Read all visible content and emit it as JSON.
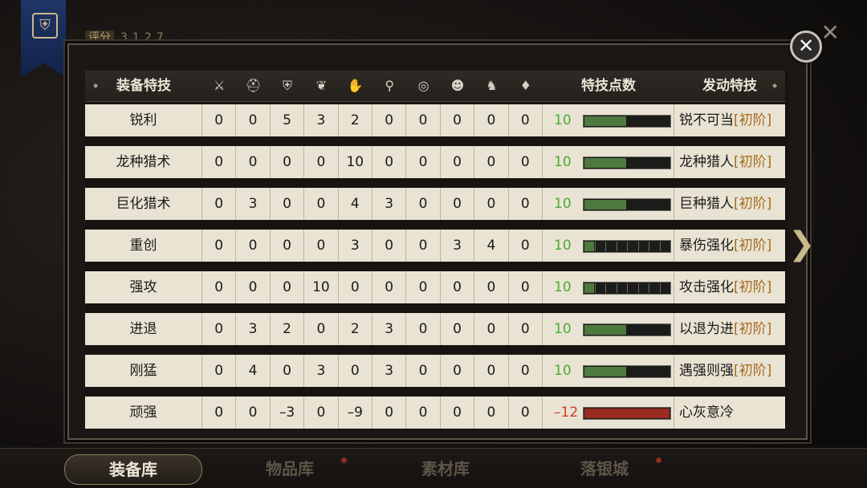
{
  "header": {
    "score_label": "评分",
    "score_value": "3127"
  },
  "table": {
    "col_name": "装备特技",
    "col_points": "特技点数",
    "col_activate": "发动特技",
    "slot_icons": [
      {
        "name": "sword-icon",
        "glyph": "⚔"
      },
      {
        "name": "helmet-icon",
        "glyph": "⛑"
      },
      {
        "name": "armor-icon",
        "glyph": "⛨"
      },
      {
        "name": "shoulder-icon",
        "glyph": "❦"
      },
      {
        "name": "gauntlet-icon",
        "glyph": "✋"
      },
      {
        "name": "boots-icon",
        "glyph": "⚲"
      },
      {
        "name": "ring-icon",
        "glyph": "◎"
      },
      {
        "name": "mask-icon",
        "glyph": "☻"
      },
      {
        "name": "mount-icon",
        "glyph": "♞"
      },
      {
        "name": "gem-icon",
        "glyph": "♦"
      }
    ],
    "rows": [
      {
        "name": "锐利",
        "vals": [
          "0",
          "0",
          "5",
          "3",
          "2",
          "0",
          "0",
          "0",
          "0",
          "0"
        ],
        "points": "10",
        "fill": 0.5,
        "segmented": false,
        "activate": "锐不可当",
        "tag": "[初阶]"
      },
      {
        "name": "龙种猎术",
        "vals": [
          "0",
          "0",
          "0",
          "0",
          "10",
          "0",
          "0",
          "0",
          "0",
          "0"
        ],
        "points": "10",
        "fill": 0.5,
        "segmented": false,
        "activate": "龙种猎人",
        "tag": "[初阶]"
      },
      {
        "name": "巨化猎术",
        "vals": [
          "0",
          "3",
          "0",
          "0",
          "4",
          "3",
          "0",
          "0",
          "0",
          "0"
        ],
        "points": "10",
        "fill": 0.5,
        "segmented": false,
        "activate": "巨种猎人",
        "tag": "[初阶]"
      },
      {
        "name": "重创",
        "vals": [
          "0",
          "0",
          "0",
          "0",
          "3",
          "0",
          "0",
          "3",
          "4",
          "0"
        ],
        "points": "10",
        "fill": 0.125,
        "segmented": true,
        "activate": "暴伤强化",
        "tag": "[初阶]"
      },
      {
        "name": "强攻",
        "vals": [
          "0",
          "0",
          "0",
          "10",
          "0",
          "0",
          "0",
          "0",
          "0",
          "0"
        ],
        "points": "10",
        "fill": 0.125,
        "segmented": true,
        "activate": "攻击强化",
        "tag": "[初阶]"
      },
      {
        "name": "进退",
        "vals": [
          "0",
          "3",
          "2",
          "0",
          "2",
          "3",
          "0",
          "0",
          "0",
          "0"
        ],
        "points": "10",
        "fill": 0.5,
        "segmented": false,
        "activate": "以退为进",
        "tag": "[初阶]"
      },
      {
        "name": "刚猛",
        "vals": [
          "0",
          "4",
          "0",
          "3",
          "0",
          "3",
          "0",
          "0",
          "0",
          "0"
        ],
        "points": "10",
        "fill": 0.5,
        "segmented": false,
        "activate": "遇强则强",
        "tag": "[初阶]"
      },
      {
        "name": "顽强",
        "vals": [
          "0",
          "0",
          "–3",
          "0",
          "–9",
          "0",
          "0",
          "0",
          "0",
          "0"
        ],
        "points": "–12",
        "fill": 1.0,
        "segmented": false,
        "negative": true,
        "activate": "心灰意冷",
        "tag": ""
      }
    ]
  },
  "bottom_tabs": [
    {
      "label": "装备库",
      "active": true,
      "dot": false
    },
    {
      "label": "物品库",
      "active": false,
      "dot": true
    },
    {
      "label": "素材库",
      "active": false,
      "dot": false
    },
    {
      "label": "落银城",
      "active": false,
      "dot": true
    }
  ],
  "colors": {
    "positive": "#4caa33",
    "negative": "#d23a28",
    "tag": "#a66b1e"
  }
}
